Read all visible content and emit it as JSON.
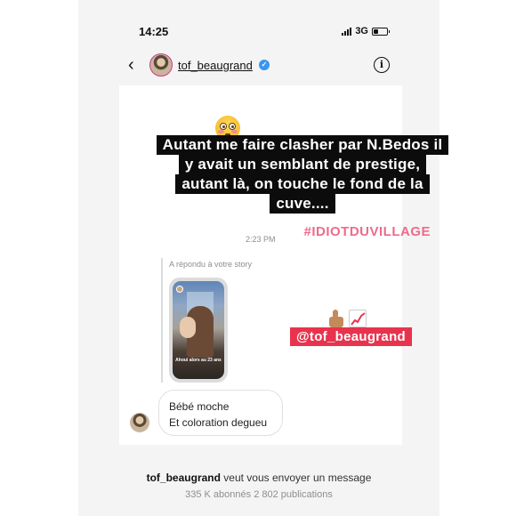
{
  "status_bar": {
    "time": "14:25",
    "network": "3G",
    "battery_level_fraction": 0.35
  },
  "header": {
    "username": "tof_beaugrand",
    "back_icon": "chevron-left-icon",
    "verified_icon": "verified-badge-icon",
    "info_icon": "info-icon"
  },
  "story_overlay": {
    "caption_lines": [
      "Autant me faire clasher par N.Bedos il",
      "y avait un semblant de prestige,",
      "autant là, on touche le fond de la",
      "cuve...."
    ],
    "hashtag": "#IDIOTDUVILLAGE",
    "mention": "@tof_beaugrand",
    "emoji_top": "flushed-face-emoji",
    "emoji_reactions": [
      "thumbs-up-emoji",
      "chart-increasing-emoji"
    ]
  },
  "conversation": {
    "timestamp": "2:23 PM",
    "reply_label": "A répondu à votre story",
    "story_thumbnail_caption": "Ahoui alors au 23 ans",
    "message_lines": [
      "Bébé moche",
      "Et coloration degueu"
    ]
  },
  "footer": {
    "request_username": "tof_beaugrand",
    "request_text": " veut vous envoyer un message",
    "stats": "335 K abonnés 2 802 publications"
  },
  "colors": {
    "hashtag": "#f06a8a",
    "mention_bg": "#e8334e",
    "verified": "#3897f0",
    "caption_bg": "#0c0c0c"
  }
}
